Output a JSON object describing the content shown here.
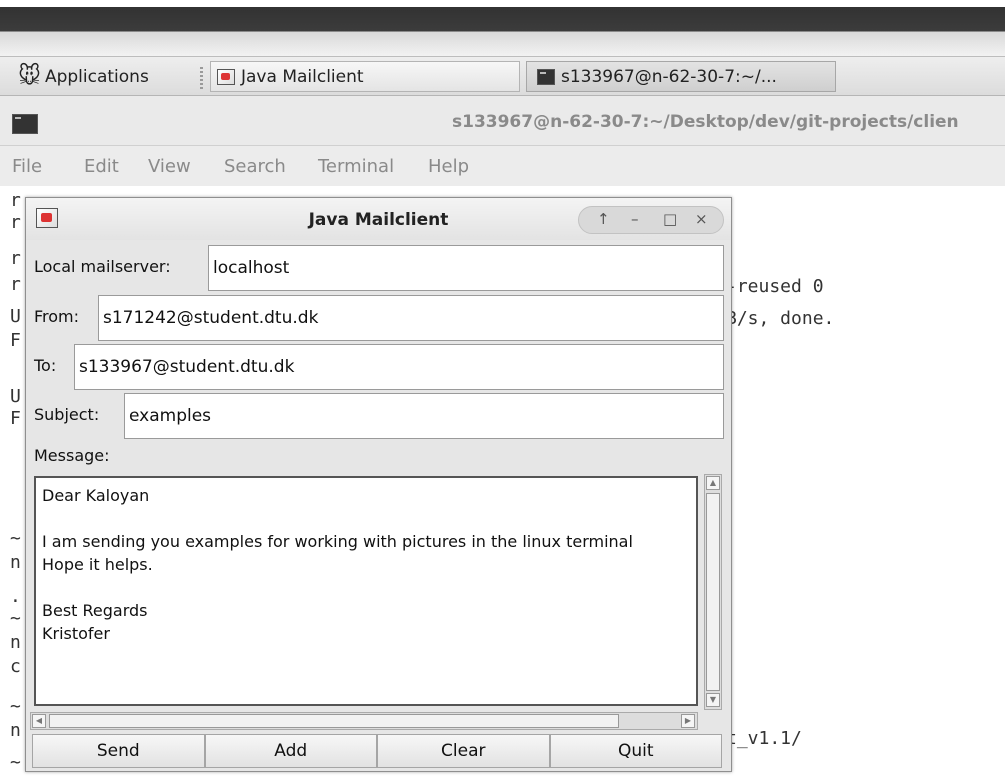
{
  "taskbar": {
    "apps_label": "Applications",
    "tasks": [
      {
        "label": "Java Mailclient"
      },
      {
        "label": "s133967@n-62-30-7:~/..."
      }
    ]
  },
  "terminal": {
    "title": "s133967@n-62-30-7:~/Desktop/dev/git-projects/clien",
    "menu": [
      "File",
      "Edit",
      "View",
      "Search",
      "Terminal",
      "Help"
    ],
    "left_chars": [
      "r",
      "r",
      "r",
      "r",
      "U",
      "F",
      "",
      "U",
      "F",
      "",
      "",
      "~",
      "n",
      ".",
      "~",
      "n",
      "c",
      "~",
      "n",
      "~"
    ],
    "right_lines": [
      "-reused 0",
      "B/s, done.",
      "t_v1.1/"
    ]
  },
  "mail_window": {
    "title": "Java Mailclient",
    "controls": [
      "↑",
      "–",
      "□",
      "×"
    ],
    "fields": {
      "mailserver": {
        "label": "Local mailserver:",
        "value": "localhost"
      },
      "from": {
        "label": "From:",
        "value": "s171242@student.dtu.dk"
      },
      "to": {
        "label": "To:",
        "value": "s133967@student.dtu.dk"
      },
      "subject": {
        "label": "Subject:",
        "value": "examples"
      }
    },
    "message_label": "Message:",
    "message_body": "Dear Kaloyan\n\nI am sending you examples for working with pictures in the linux terminal\nHope it helps.\n\nBest Regards\nKristofer",
    "buttons": {
      "send": "Send",
      "add": "Add",
      "clear": "Clear",
      "quit": "Quit"
    }
  }
}
